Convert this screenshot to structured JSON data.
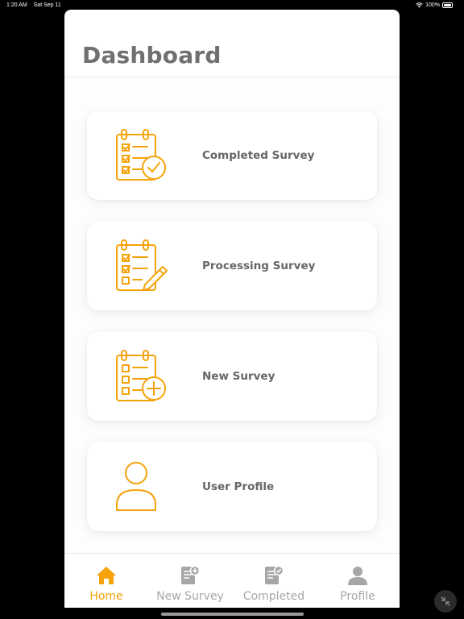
{
  "status_bar": {
    "time": "1:20 AM",
    "date": "Sat Sep 11",
    "battery": "100%"
  },
  "header": {
    "title": "Dashboard"
  },
  "cards": [
    {
      "label": "Completed Survey",
      "icon": "clipboard-check-icon"
    },
    {
      "label": "Processing Survey",
      "icon": "clipboard-edit-icon"
    },
    {
      "label": "New Survey",
      "icon": "clipboard-add-icon"
    },
    {
      "label": "User Profile",
      "icon": "user-icon"
    }
  ],
  "tabs": [
    {
      "label": "Home",
      "icon": "home-icon",
      "active": true
    },
    {
      "label": "New Survey",
      "icon": "new-survey-icon",
      "active": false
    },
    {
      "label": "Completed",
      "icon": "completed-icon",
      "active": false
    },
    {
      "label": "Profile",
      "icon": "profile-icon",
      "active": false
    }
  ],
  "colors": {
    "accent": "#f5a30a",
    "inactive": "#a6a6a6",
    "title": "#707070",
    "label": "#666666"
  }
}
